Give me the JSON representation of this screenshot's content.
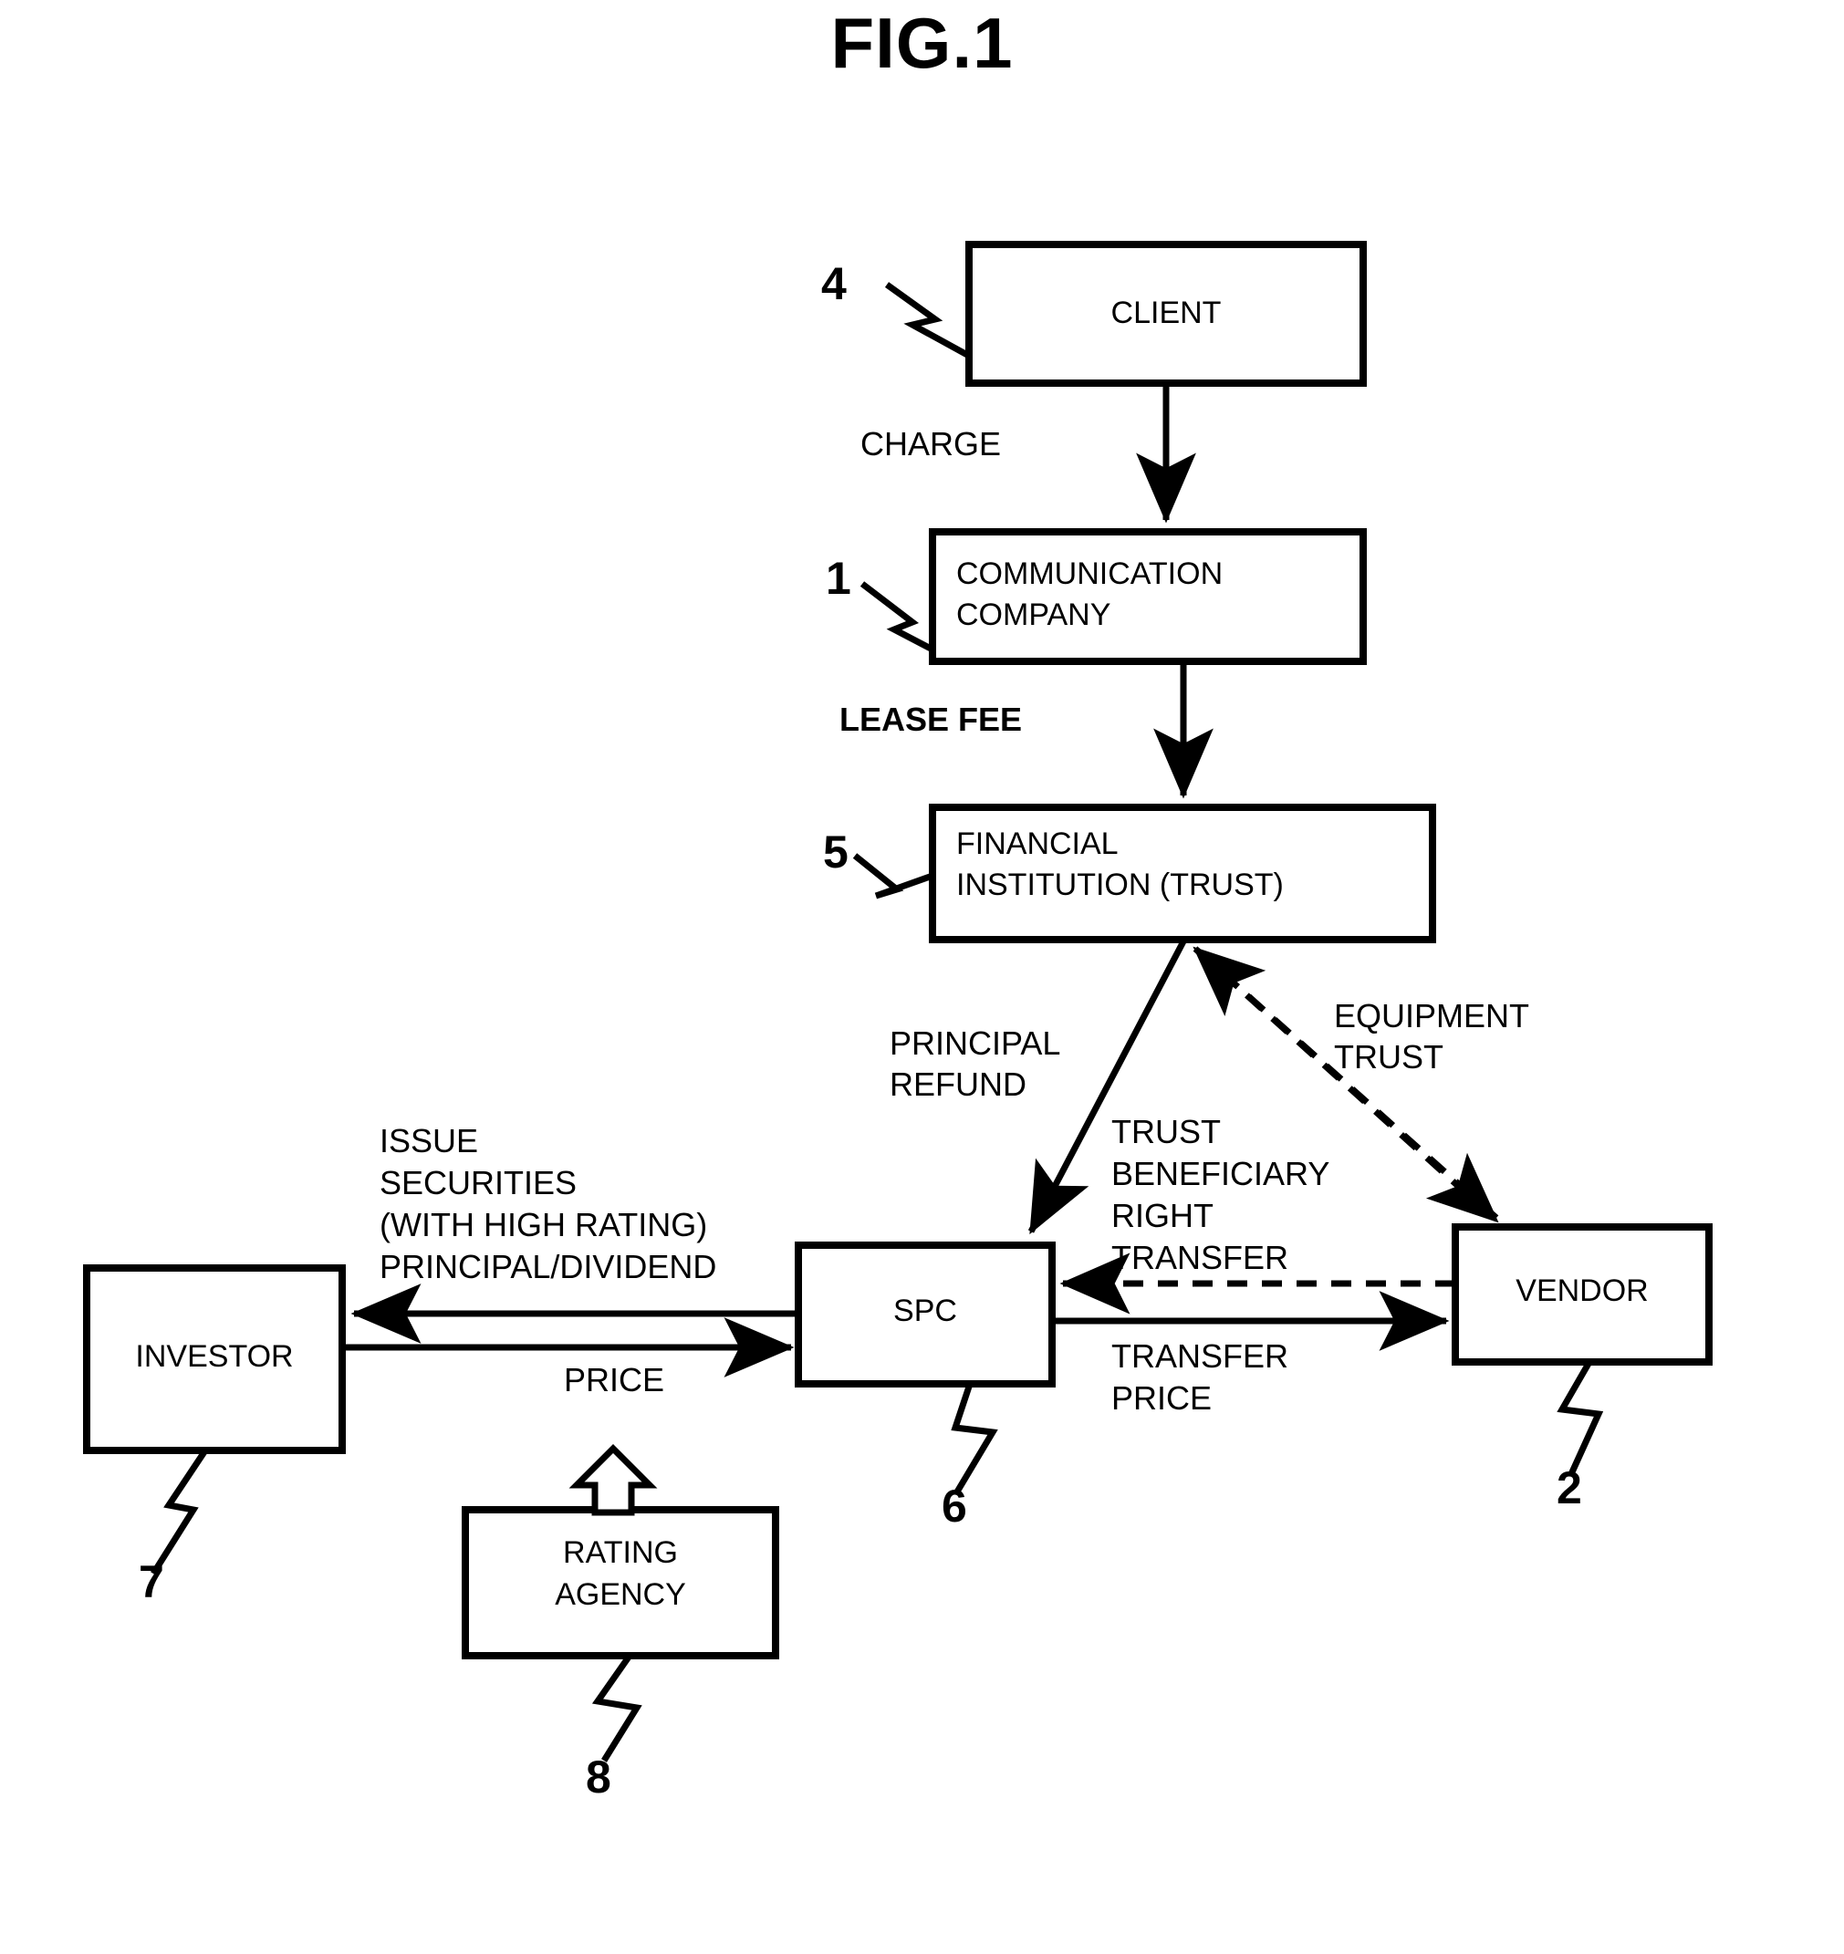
{
  "figure": {
    "title": "FIG.1",
    "type": "patent-flow-diagram"
  },
  "nodes": [
    {
      "id": "client",
      "label": "CLIENT",
      "ref": "4"
    },
    {
      "id": "comcom",
      "label": "COMMUNICATION\nCOMPANY",
      "ref": "1"
    },
    {
      "id": "fininst",
      "label": "FINANCIAL\nINSTITUTION (TRUST)",
      "ref": "5"
    },
    {
      "id": "investor",
      "label": "INVESTOR",
      "ref": "7"
    },
    {
      "id": "spc",
      "label": "SPC",
      "ref": "6"
    },
    {
      "id": "vendor",
      "label": "VENDOR",
      "ref": "2"
    },
    {
      "id": "rating",
      "label": "RATING\nAGENCY",
      "ref": "8"
    }
  ],
  "node_labels": {
    "client": "CLIENT",
    "communication_company_line1": "COMMUNICATION",
    "communication_company_line2": "COMPANY",
    "financial_institution_line1": "FINANCIAL",
    "financial_institution_line2": "INSTITUTION (TRUST)",
    "investor": "INVESTOR",
    "spc": "SPC",
    "vendor": "VENDOR",
    "rating_agency_line1": "RATING",
    "rating_agency_line2": "AGENCY"
  },
  "ref_numbers": {
    "client": "4",
    "communication_company": "1",
    "financial_institution": "5",
    "investor": "7",
    "spc": "6",
    "vendor": "2",
    "rating_agency": "8"
  },
  "edges": [
    {
      "id": "charge",
      "from": "client",
      "to": "fininst_chain",
      "label": "CHARGE",
      "style": "solid"
    },
    {
      "id": "lease-fee",
      "from": "comcom",
      "to": "fininst",
      "label": "LEASE FEE",
      "style": "solid"
    },
    {
      "id": "principal-refund",
      "from": "fininst",
      "to": "spc",
      "label": "PRINCIPAL\nREFUND",
      "style": "solid"
    },
    {
      "id": "equipment-trust",
      "from": "vendor",
      "to": "fininst",
      "label": "EQUIPMENT\nTRUST",
      "style": "dashed"
    },
    {
      "id": "trust-beneficiary-right-transfer",
      "from": "vendor",
      "to": "spc",
      "label": "TRUST\nBENEFICIARY\nRIGHT\nTRANSFER",
      "style": "dashed"
    },
    {
      "id": "transfer-price",
      "from": "spc",
      "to": "vendor",
      "label": "TRANSFER\nPRICE",
      "style": "solid"
    },
    {
      "id": "issue-securities",
      "from": "spc",
      "to": "investor",
      "label": "ISSUE\nSECURITIES\n(WITH HIGH RATING)\nPRINCIPAL/DIVIDEND",
      "style": "solid"
    },
    {
      "id": "price",
      "from": "investor",
      "to": "spc",
      "label": "PRICE",
      "style": "solid"
    },
    {
      "id": "rating-up",
      "from": "rating",
      "to": "securities",
      "label": "",
      "style": "hollow-arrow"
    }
  ],
  "edge_labels": {
    "charge": "CHARGE",
    "lease_fee": "LEASE FEE",
    "principal_refund_line1": "PRINCIPAL",
    "principal_refund_line2": "REFUND",
    "equipment_trust_line1": "EQUIPMENT",
    "equipment_trust_line2": "TRUST",
    "tbrt_line1": "TRUST",
    "tbrt_line2": "BENEFICIARY",
    "tbrt_line3": "RIGHT",
    "tbrt_line4": "TRANSFER",
    "transfer_price_line1": "TRANSFER",
    "transfer_price_line2": "PRICE",
    "issue_line1": "ISSUE",
    "issue_line2": "SECURITIES",
    "issue_line3": "(WITH HIGH RATING)",
    "issue_line4": "PRINCIPAL/DIVIDEND",
    "price": "PRICE"
  },
  "colors": {
    "ink": "#000000",
    "background": "#ffffff"
  }
}
